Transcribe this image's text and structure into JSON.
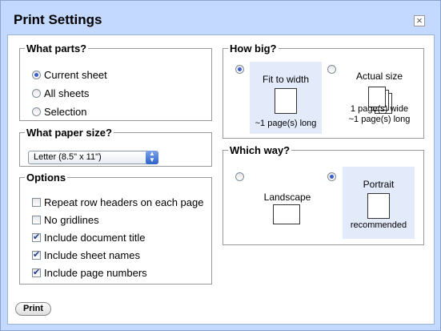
{
  "dialog": {
    "title": "Print Settings",
    "close_icon": "close-icon"
  },
  "what_parts": {
    "legend": "What parts?",
    "options": [
      {
        "label": "Current sheet",
        "selected": true
      },
      {
        "label": "All sheets",
        "selected": false
      },
      {
        "label": "Selection",
        "selected": false
      }
    ]
  },
  "paper_size": {
    "legend": "What paper size?",
    "value": "Letter (8.5\" x 11\")"
  },
  "options": {
    "legend": "Options",
    "items": [
      {
        "label": "Repeat row headers on each page",
        "checked": false
      },
      {
        "label": "No gridlines",
        "checked": false
      },
      {
        "label": "Include document title",
        "checked": true
      },
      {
        "label": "Include sheet names",
        "checked": true
      },
      {
        "label": "Include page numbers",
        "checked": true
      }
    ]
  },
  "how_big": {
    "legend": "How big?",
    "fit": {
      "title": "Fit to width",
      "caption": "~1 page(s) long",
      "selected": true
    },
    "actual": {
      "title": "Actual size",
      "caption1": "1 page(s) wide",
      "caption2": "~1 page(s) long",
      "selected": false
    }
  },
  "which_way": {
    "legend": "Which way?",
    "landscape": {
      "title": "Landscape",
      "selected": false
    },
    "portrait": {
      "title": "Portrait",
      "caption": "recommended",
      "selected": true
    }
  },
  "print_button": "Print",
  "colors": {
    "accent": "#3a5fcd",
    "frame": "#c3d9ff",
    "highlight": "#e3ebfb"
  }
}
